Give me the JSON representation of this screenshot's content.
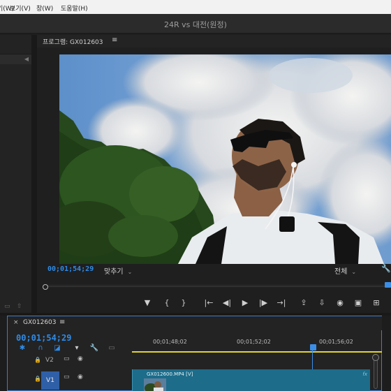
{
  "menubar": {
    "items": [
      "기(W)",
      "보기(V)",
      "창(W)",
      "도움말(H)"
    ]
  },
  "window": {
    "title": "24R vs 대전(원정)"
  },
  "program_monitor": {
    "tab_label": "프로그램: GX012603",
    "menu_icon": "≡",
    "timecode": "00;01;54;29",
    "fit_label": "맞추기",
    "resolution_label": "전체",
    "playhead_fraction": 0.99,
    "controls": [
      {
        "name": "add-marker-icon",
        "glyph": "▼"
      },
      {
        "name": "mark-in-icon",
        "glyph": "{"
      },
      {
        "name": "mark-out-icon",
        "glyph": "}"
      },
      {
        "name": "go-to-in-icon",
        "glyph": "|←"
      },
      {
        "name": "step-back-icon",
        "glyph": "◀|"
      },
      {
        "name": "play-icon",
        "glyph": "▶"
      },
      {
        "name": "step-forward-icon",
        "glyph": "|▶"
      },
      {
        "name": "go-to-out-icon",
        "glyph": "→|"
      },
      {
        "name": "lift-icon",
        "glyph": "⇪"
      },
      {
        "name": "extract-icon",
        "glyph": "⇩"
      },
      {
        "name": "export-frame-icon",
        "glyph": "◉"
      },
      {
        "name": "comparison-view-icon",
        "glyph": "▣"
      },
      {
        "name": "button-editor-icon",
        "glyph": "⊞"
      }
    ]
  },
  "timeline": {
    "sequence_name": "GX012603",
    "close_icon": "×",
    "menu_icon": "≡",
    "timecode": "00;01;54;29",
    "ruler_labels": [
      "00;01;48;02",
      "00;01;52;02",
      "00;01;56;02"
    ],
    "tracks": [
      {
        "name": "V2",
        "selected": false
      },
      {
        "name": "V1",
        "selected": true
      }
    ],
    "clip": {
      "label": "GX012600.MP4 [V]",
      "fx": "fx"
    }
  },
  "colors": {
    "accent": "#2d8ceb",
    "clip": "#1c6c8a",
    "work_area": "#e0d531"
  }
}
